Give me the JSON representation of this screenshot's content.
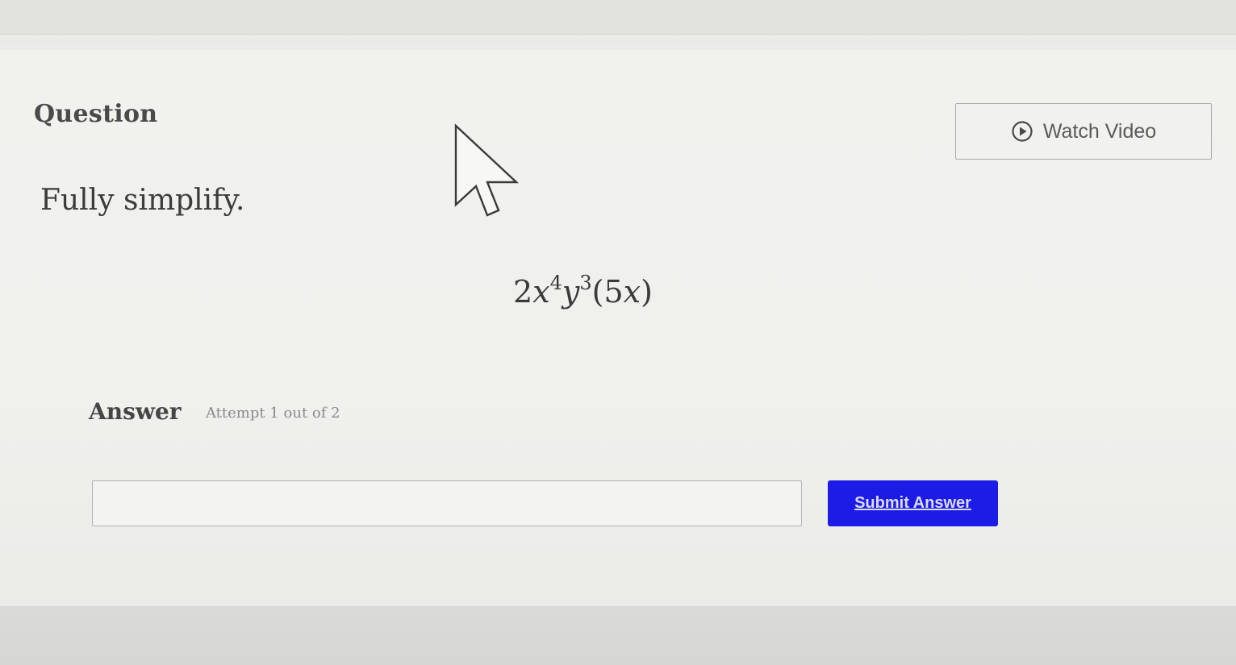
{
  "question": {
    "heading": "Question",
    "watch_video_label": "Watch Video",
    "watch_video_icon": "play-circle-icon",
    "prompt": "Fully simplify."
  },
  "expression": {
    "coef": "2",
    "var_x": "x",
    "exp_x": "4",
    "var_y": "y",
    "exp_y": "3",
    "open_paren": "(",
    "inner_coef": "5",
    "inner_var": "x",
    "close_paren": ")"
  },
  "answer": {
    "heading": "Answer",
    "attempt_text": "Attempt 1 out of 2",
    "input_value": "",
    "input_placeholder": "",
    "submit_label": "Submit Answer"
  },
  "colors": {
    "submit_bg": "#1c1ce6",
    "page_bg": "#eeeeeb"
  },
  "cursor": {
    "icon": "mouse-pointer-icon"
  }
}
